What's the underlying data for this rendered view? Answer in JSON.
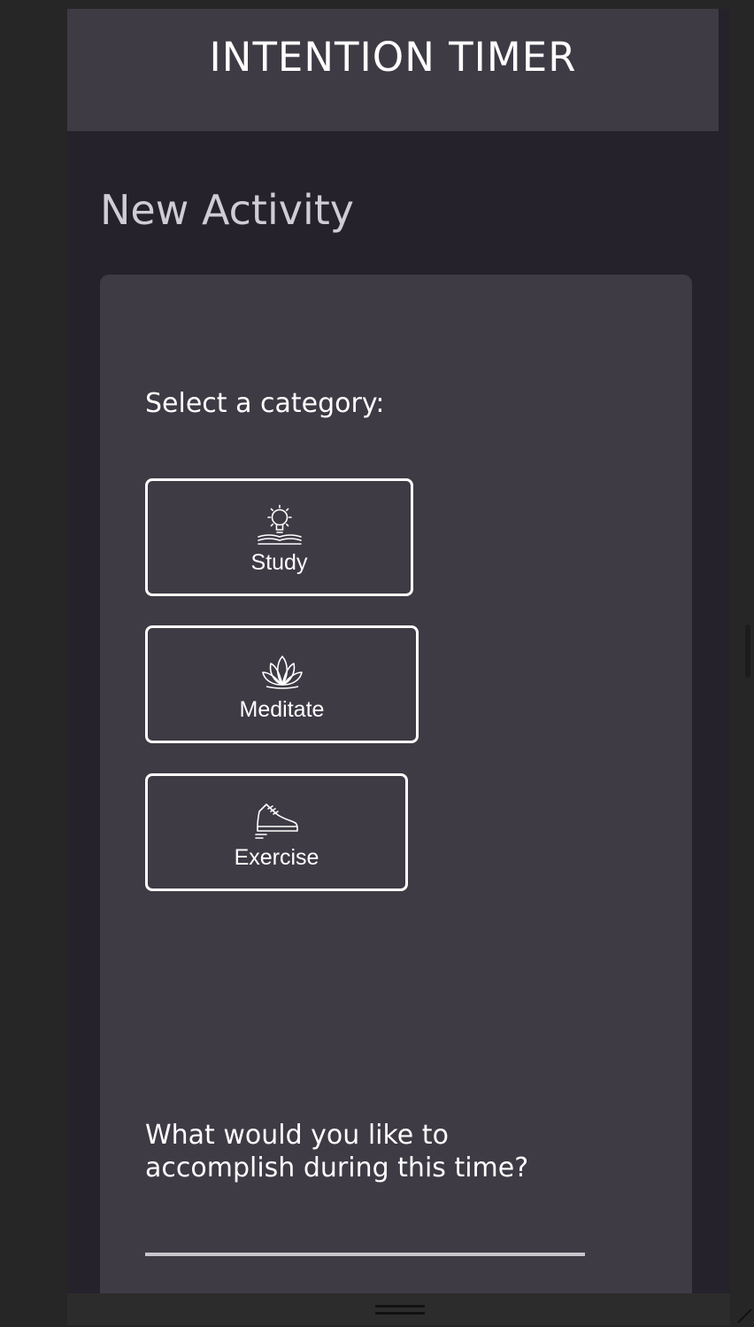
{
  "header": {
    "title": "INTENTION TIMER"
  },
  "page": {
    "title": "New Activity"
  },
  "form": {
    "category_prompt": "Select a category:",
    "categories": [
      {
        "label": "Study",
        "icon": "lightbulb-book-icon"
      },
      {
        "label": "Meditate",
        "icon": "lotus-icon"
      },
      {
        "label": "Exercise",
        "icon": "sneaker-icon"
      }
    ],
    "goal_prompt": "What would you like to accomplish during this time?",
    "goal_value": ""
  },
  "colors": {
    "background": "#262626",
    "app_background": "#25222c",
    "panel": "#3e3b45",
    "text": "#ffffff",
    "muted_text": "#cfcdd3",
    "underline": "#c8c6cc"
  }
}
